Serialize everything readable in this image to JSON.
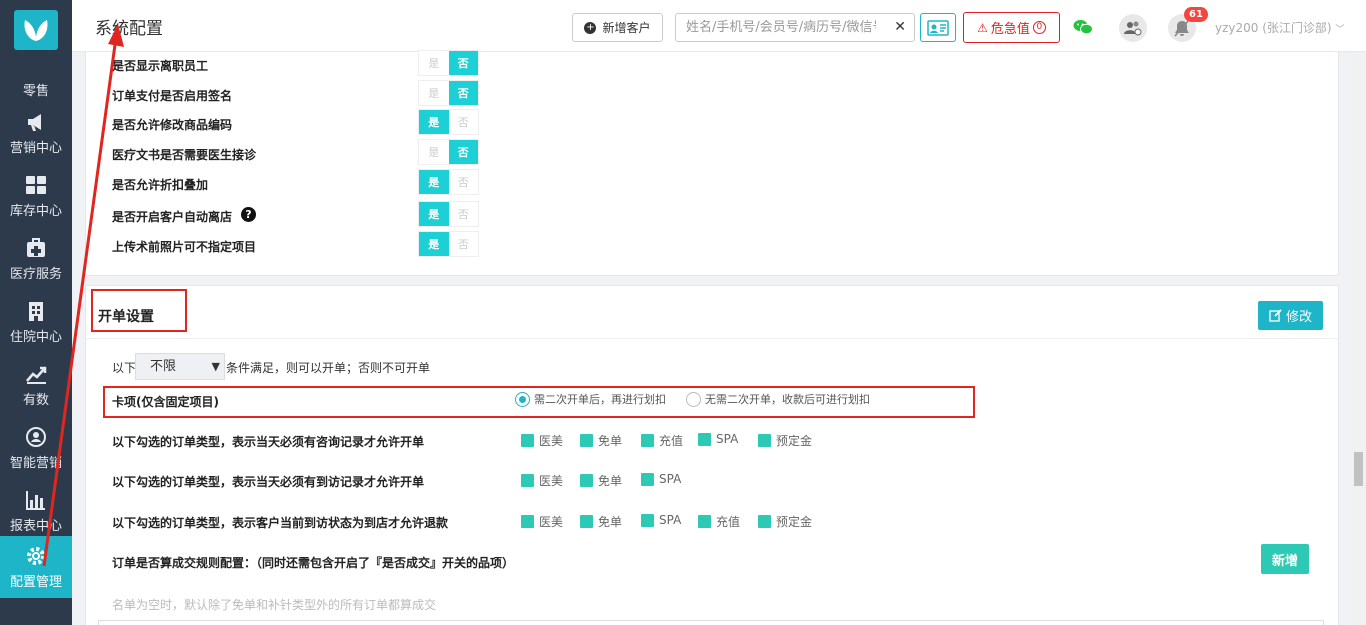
{
  "sidebar": {
    "items": [
      {
        "label": "零售",
        "icon": "hand-icon"
      },
      {
        "label": "营销中心",
        "icon": "megaphone-icon"
      },
      {
        "label": "库存中心",
        "icon": "grid-icon"
      },
      {
        "label": "医疗服务",
        "icon": "medical-kit-icon"
      },
      {
        "label": "住院中心",
        "icon": "hospital-icon"
      },
      {
        "label": "有数",
        "icon": "trend-icon"
      },
      {
        "label": "智能营销",
        "icon": "smart-icon"
      },
      {
        "label": "报表中心",
        "icon": "bar-chart-icon"
      },
      {
        "label": "配置管理",
        "icon": "gear-icon"
      }
    ],
    "active_index": 8
  },
  "header": {
    "title": "系统配置",
    "new_customer": "新增客户",
    "search_placeholder": "姓名/手机号/会员号/病历号/微信号",
    "danger_label": "危急值",
    "danger_count": "0",
    "notification_count": "61",
    "user": "yzy200 (张江门诊部)"
  },
  "toggles": [
    {
      "label": "是否显示离职员工",
      "yes": "是",
      "no": "否",
      "value": "no"
    },
    {
      "label": "订单支付是否启用签名",
      "yes": "是",
      "no": "否",
      "value": "no"
    },
    {
      "label": "是否允许修改商品编码",
      "yes": "是",
      "no": "否",
      "value": "yes"
    },
    {
      "label": "医疗文书是否需要医生接诊",
      "yes": "是",
      "no": "否",
      "value": "no"
    },
    {
      "label": "是否允许折扣叠加",
      "yes": "是",
      "no": "否",
      "value": "yes"
    },
    {
      "label": "是否开启客户自动离店",
      "yes": "是",
      "no": "否",
      "value": "yes"
    },
    {
      "label": "上传术前照片可不指定项目",
      "yes": "是",
      "no": "否",
      "value": "yes"
    }
  ],
  "order_settings": {
    "title": "开单设置",
    "modify_button": "修改",
    "limit_prefix": "以下",
    "limit_value": "不限",
    "limit_suffix": "条件满足，则可以开单；否则不可开单",
    "card_label": "卡项(仅含固定项目)",
    "card_options": [
      "需二次开单后，再进行划扣",
      "无需二次开单，收款后可进行划扣"
    ],
    "card_selected": 0,
    "consult_label": "以下勾选的订单类型，表示当天必须有咨询记录才允许开单",
    "consult_types": [
      "医美",
      "免单",
      "充值",
      "SPA",
      "预定金"
    ],
    "visit_label": "以下勾选的订单类型，表示当天必须有到访记录才允许开单",
    "visit_types": [
      "医美",
      "免单",
      "SPA"
    ],
    "refund_label": "以下勾选的订单类型，表示客户当前到访状态为到店才允许退款",
    "refund_types": [
      "医美",
      "免单",
      "SPA",
      "充值",
      "预定金"
    ],
    "deal_rule_label": "订单是否算成交规则配置：（同时还需包含开启了『是否成交』开关的品项）",
    "new_button": "新增",
    "hint": "名单为空时，默认除了免单和补针类型外的所有订单都算成交"
  },
  "colors": {
    "sidebar": "#2d3a4b",
    "accent": "#1fb5c8",
    "toggle_on": "#1dd0d6",
    "checkbox": "#2ec9b4",
    "danger": "#e02020",
    "annotation": "#e0261f"
  }
}
